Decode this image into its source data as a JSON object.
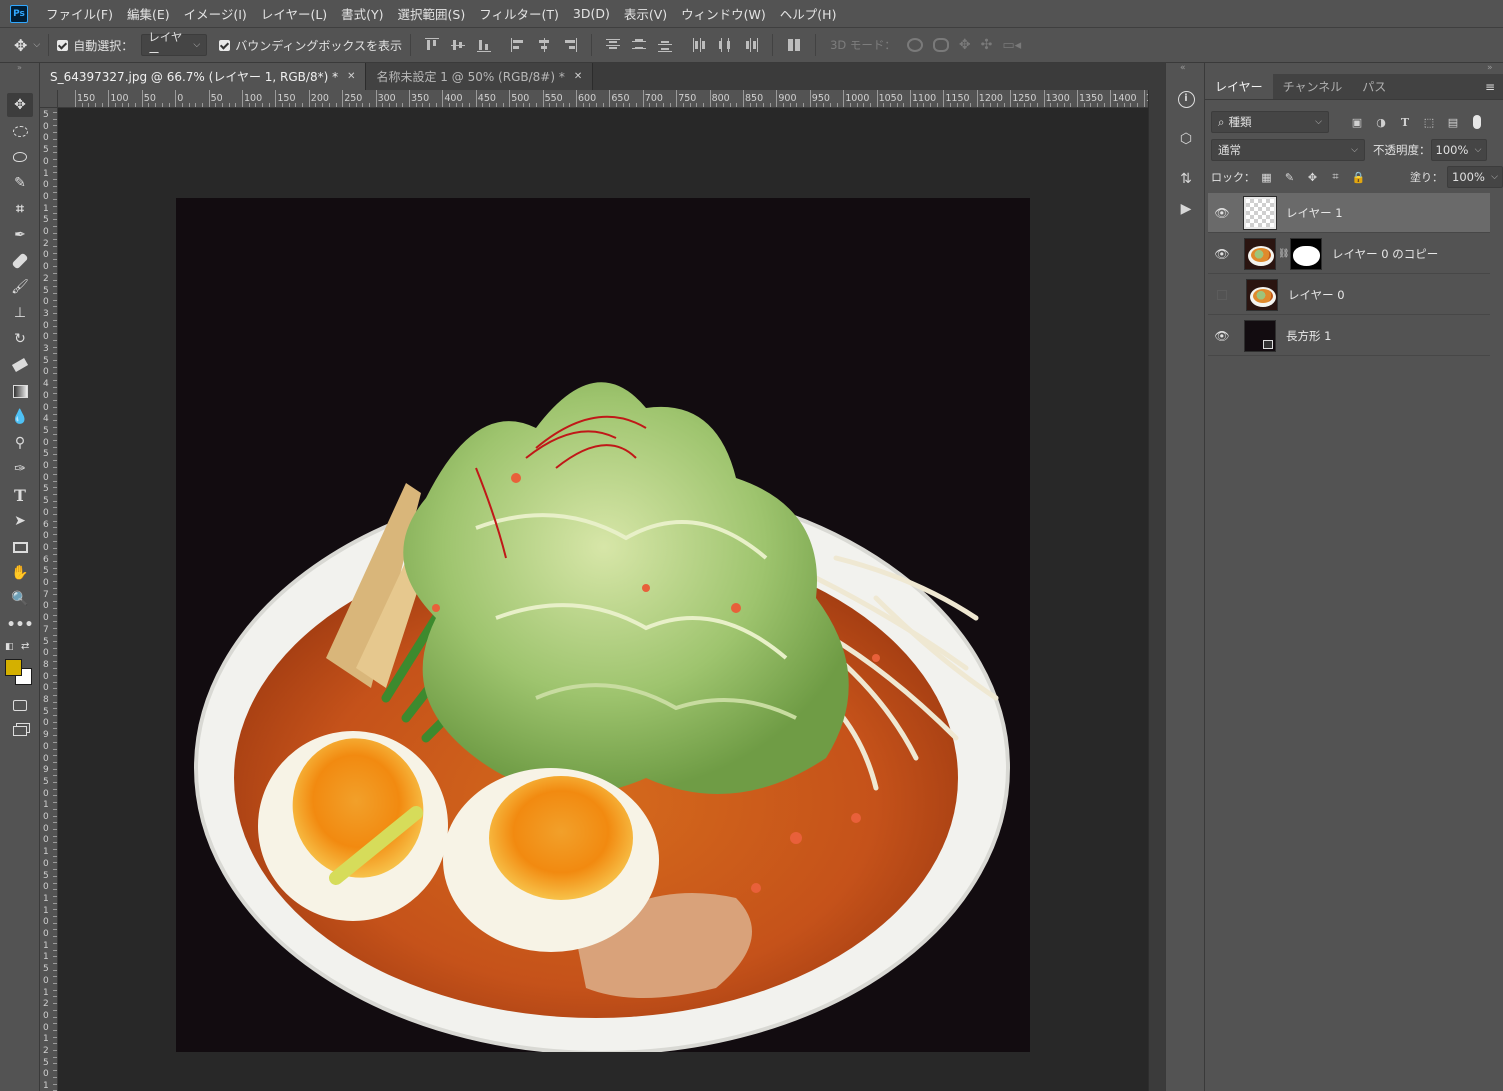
{
  "app": {
    "logo": "Ps"
  },
  "menu": [
    "ファイル(F)",
    "編集(E)",
    "イメージ(I)",
    "レイヤー(L)",
    "書式(Y)",
    "選択範囲(S)",
    "フィルター(T)",
    "3D(D)",
    "表示(V)",
    "ウィンドウ(W)",
    "ヘルプ(H)"
  ],
  "options": {
    "auto_select_label": "自動選択：",
    "auto_select_target": "レイヤー",
    "bounding_box_label": "バウンディングボックスを表示",
    "mode_3d_label": "3D モード："
  },
  "tabs": [
    {
      "label": "S_64397327.jpg @ 66.7% (レイヤー 1, RGB/8*) *",
      "close": "✕"
    },
    {
      "label": "名称未設定 1 @ 50% (RGB/8#) *",
      "close": "✕"
    }
  ],
  "ruler": {
    "top": [
      "150",
      "100",
      "50",
      "0",
      "50",
      "100",
      "150",
      "200",
      "250",
      "300",
      "350",
      "400",
      "450",
      "500",
      "550",
      "600",
      "650",
      "700",
      "750",
      "800",
      "850",
      "900",
      "950",
      "1000",
      "1050",
      "1100",
      "1150",
      "1200",
      "1250",
      "1300",
      "1350",
      "1400",
      "1"
    ],
    "left": [
      "5",
      "0",
      "0",
      "5",
      "0",
      "1",
      "0",
      "0",
      "1",
      "5",
      "0",
      "2",
      "0",
      "0",
      "2",
      "5",
      "0",
      "3",
      "0",
      "0",
      "3",
      "5",
      "0",
      "4",
      "0",
      "0",
      "4",
      "5",
      "0",
      "5",
      "0",
      "0",
      "5",
      "5",
      "0",
      "6",
      "0",
      "0",
      "6",
      "5",
      "0",
      "7",
      "0",
      "0",
      "7",
      "5",
      "0",
      "8",
      "0",
      "0",
      "8",
      "5",
      "0",
      "9",
      "0",
      "0",
      "9",
      "5",
      "0",
      "1",
      "0",
      "0",
      "0",
      "1",
      "0",
      "5",
      "0",
      "1",
      "1",
      "0",
      "0",
      "1",
      "1",
      "5",
      "0",
      "1",
      "2",
      "0",
      "0",
      "1",
      "2",
      "5",
      "0",
      "1",
      "3"
    ]
  },
  "colors": {
    "foreground": "#d4b000",
    "background": "#ffffff",
    "canvas_bg": "#120c10",
    "accent": "#31a8ff"
  },
  "panel": {
    "tabs": [
      "レイヤー",
      "チャンネル",
      "パス"
    ],
    "filter_kind": "種類",
    "blend_mode": "通常",
    "opacity_label": "不透明度：",
    "opacity_value": "100%",
    "lock_label": "ロック：",
    "fill_label": "塗り：",
    "fill_value": "100%",
    "layers": [
      {
        "name": "レイヤー 1",
        "visible": true,
        "selected": true,
        "thumb": "transparent"
      },
      {
        "name": "レイヤー 0 のコピー",
        "visible": true,
        "selected": false,
        "thumb": "food",
        "mask": true
      },
      {
        "name": "レイヤー 0",
        "visible": false,
        "selected": false,
        "thumb": "food"
      },
      {
        "name": "長方形 1",
        "visible": true,
        "selected": false,
        "thumb": "shape"
      }
    ]
  },
  "icons": {
    "move": "move-icon",
    "marquee": "elliptical-marquee-icon",
    "lasso": "lasso-icon",
    "quick_select": "quick-select-icon",
    "crop": "crop-icon",
    "eyedropper": "eyedropper-icon",
    "healing": "healing-brush-icon",
    "brush": "brush-icon",
    "stamp": "clone-stamp-icon",
    "history_brush": "history-brush-icon",
    "eraser": "eraser-icon",
    "gradient": "gradient-icon",
    "blur": "blur-icon",
    "dodge": "dodge-icon",
    "pen": "pen-icon",
    "type": "type-icon",
    "path_select": "path-select-icon",
    "rectangle": "rectangle-icon",
    "hand": "hand-icon",
    "zoom": "zoom-icon",
    "more": "more-icon"
  }
}
